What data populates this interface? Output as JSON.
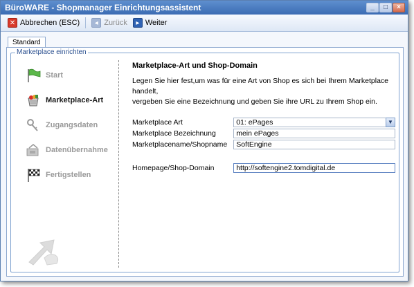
{
  "window": {
    "title": "BüroWARE - Shopmanager Einrichtungsassistent",
    "controls": {
      "minimize": "_",
      "maximize": "□",
      "close": "×"
    }
  },
  "toolbar": {
    "cancel_label": "Abbrechen (ESC)",
    "back_label": "Zurück",
    "next_label": "Weiter"
  },
  "tabs": [
    {
      "label": "Standard"
    }
  ],
  "group": {
    "title": "Marketplace einrichten"
  },
  "steps": [
    {
      "label": "Start",
      "icon": "flag-icon"
    },
    {
      "label": "Marketplace-Art",
      "icon": "shopping-basket-icon"
    },
    {
      "label": "Zugangsdaten",
      "icon": "keys-icon"
    },
    {
      "label": "Datenübernahme",
      "icon": "transfer-icon"
    },
    {
      "label": "Fertigstellen",
      "icon": "checkered-flag-icon"
    }
  ],
  "panel": {
    "title": "Marketplace-Art und Shop-Domain",
    "description_line1": "Legen Sie hier fest,um was für eine Art von Shop es sich bei Ihrem Marketplace handelt,",
    "description_line2": "vergeben Sie eine Bezeichnung und geben Sie ihre URL zu Ihrem Shop ein.",
    "fields": {
      "marketplace_art": {
        "label": "Marketplace Art",
        "value": "01: ePages"
      },
      "marketplace_bezeichnung": {
        "label": "Marketplace Bezeichnung",
        "value": "mein ePages"
      },
      "marketplace_name": {
        "label": "Marketplacename/Shopname",
        "value": "SoftEngine"
      },
      "homepage": {
        "label": "Homepage/Shop-Domain",
        "value": "http://softengine2.tomdigital.de"
      }
    }
  },
  "colors": {
    "titlebar": "#3b6cb3",
    "accent": "#2a4f8f",
    "active_step": "#1a1a1a",
    "inactive_step": "#9a9a9a"
  }
}
